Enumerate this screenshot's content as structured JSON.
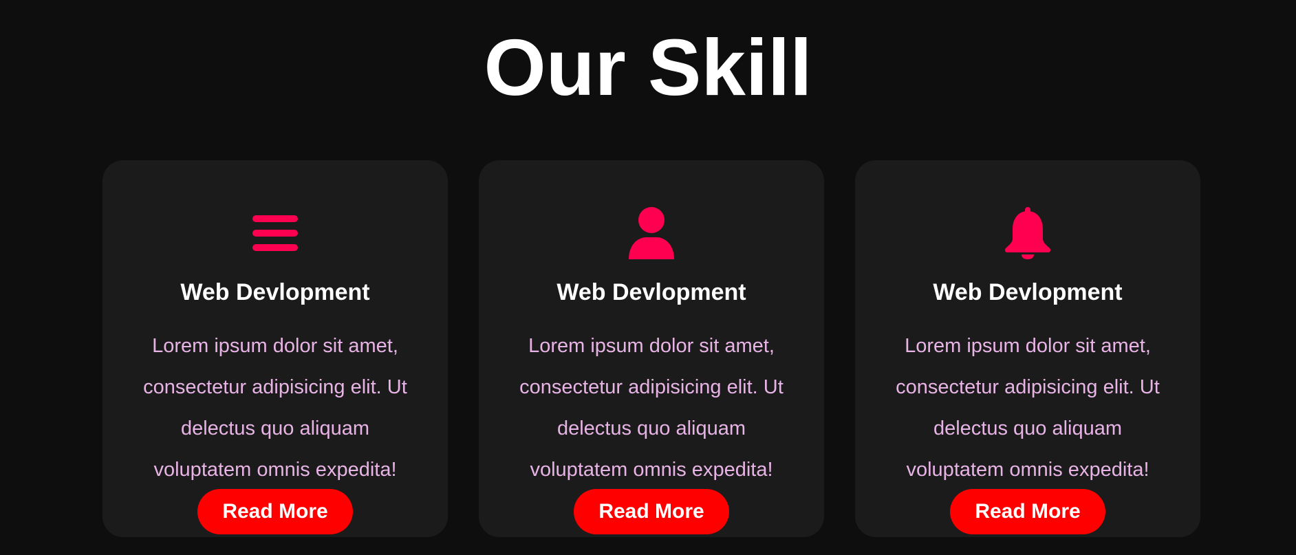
{
  "section": {
    "title": "Our Skill"
  },
  "colors": {
    "background": "#0e0e0e",
    "card_background": "#1b1b1b",
    "accent_icon": "#ff0050",
    "button": "#ff0000",
    "body_text": "#e8b4e6",
    "heading_text": "#ffffff"
  },
  "cards": [
    {
      "icon": "menu-bars-icon",
      "title": "Web Devlopment",
      "text": "Lorem ipsum dolor sit amet, consectetur adipisicing elit. Ut delectus quo aliquam voluptatem omnis expedita!",
      "button_label": "Read More"
    },
    {
      "icon": "user-icon",
      "title": "Web Devlopment",
      "text": "Lorem ipsum dolor sit amet, consectetur adipisicing elit. Ut delectus quo aliquam voluptatem omnis expedita!",
      "button_label": "Read More"
    },
    {
      "icon": "bell-icon",
      "title": "Web Devlopment",
      "text": "Lorem ipsum dolor sit amet, consectetur adipisicing elit. Ut delectus quo aliquam voluptatem omnis expedita!",
      "button_label": "Read More"
    }
  ]
}
